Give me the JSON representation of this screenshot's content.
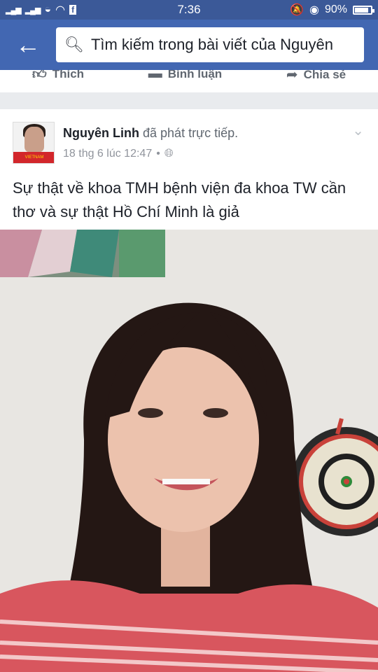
{
  "status_bar": {
    "time": "7:36",
    "battery": "90%",
    "icons": [
      "signal-icon",
      "signal-icon",
      "carrier-icon",
      "wifi-icon",
      "facebook-icon",
      "mute-icon",
      "eye-icon",
      "battery-icon"
    ]
  },
  "app_bar": {
    "back_icon": "arrow-left-icon",
    "search_placeholder": "Tìm kiếm trong bài viết của Nguyên"
  },
  "prev_post_actions": [
    {
      "label": "Thích",
      "icon": "like-icon"
    },
    {
      "label": "Bình luận",
      "icon": "comment-icon"
    },
    {
      "label": "Chia sẻ",
      "icon": "share-icon"
    }
  ],
  "post": {
    "author": "Nguyên Linh",
    "action": "đã phát trực tiếp.",
    "timestamp": "18 thg 6 lúc 12:47",
    "privacy_icon": "globe-icon",
    "avatar_text": "VIETNAM",
    "text": "Sự thật về khoa TMH bệnh viện đa khoa TW cần thơ và sự thật Hồ Chí Minh là giả"
  },
  "colors": {
    "header": "#4267b2",
    "status": "#3b5998"
  }
}
